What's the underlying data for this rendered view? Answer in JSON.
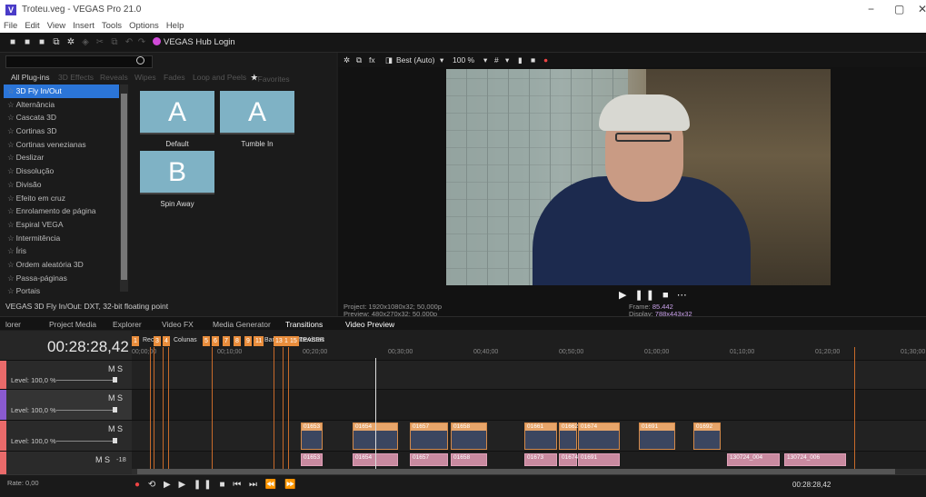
{
  "window": {
    "title": "Troteu.veg - VEGAS Pro 21.0",
    "minimize": "−",
    "maximize": "▢",
    "close": "✕"
  },
  "menu": [
    "File",
    "Edit",
    "View",
    "Insert",
    "Tools",
    "Options",
    "Help"
  ],
  "toolbar": {
    "hub_label": "VEGAS Hub Login"
  },
  "plugins": {
    "tabs": [
      "All Plug-ins",
      "3D Effects",
      "Reveals",
      "Wipes",
      "Fades",
      "Loop and Peels",
      "Favorites"
    ],
    "items": [
      "3D Fly In/Out",
      "Alternância",
      "Cascata 3D",
      "Cortinas 3D",
      "Cortinas venezianas",
      "Deslizar",
      "Dissolução",
      "Divisão",
      "Efeito em cruz",
      "Enrolamento de página",
      "Espiral VEGA",
      "Intermitência",
      "Íris",
      "Ordem aleatória 3D",
      "Passa-páginas",
      "Portais"
    ],
    "selected_index": 0,
    "presets": [
      {
        "glyph": "A",
        "label": "Default"
      },
      {
        "glyph": "A",
        "label": "Tumble In"
      },
      {
        "glyph": "B",
        "label": "Spin Away"
      }
    ],
    "status": "VEGAS 3D Fly In/Out: DXT, 32-bit floating point"
  },
  "window_tabs": [
    "lorer",
    "Project Media",
    "Explorer",
    "Video FX",
    "Media Generator",
    "Transitions",
    "Video Preview"
  ],
  "viewer": {
    "quality": "Best (Auto)",
    "zoom": "100 %",
    "project_label": "Project:",
    "project_value": "1920x1080x32; 50,000p",
    "preview_label": "Preview:",
    "preview_value": "480x270x32; 50,000p",
    "frame_label": "Frame:",
    "frame_value": "85.442",
    "display_label": "Display:",
    "display_value": "788x443x32"
  },
  "timeline": {
    "timecode": "00:28:28,42",
    "markers": [
      {
        "n": "1",
        "label": "Reci"
      },
      {
        "n": "3",
        "label": ""
      },
      {
        "n": "4",
        "label": "Colunas"
      },
      {
        "n": "5",
        "label": ""
      },
      {
        "n": "6",
        "label": ""
      },
      {
        "n": "7",
        "label": ""
      },
      {
        "n": "8",
        "label": ""
      },
      {
        "n": "9",
        "label": ""
      },
      {
        "n": "11",
        "label": "Banh"
      },
      {
        "n": "13",
        "label": ""
      },
      {
        "n": "14",
        "label": "entrevistas"
      },
      {
        "n": "15",
        "label": "TEASER"
      }
    ],
    "ruler": [
      "00;00;00",
      "00;10;00",
      "00;20;00",
      "00;30;00",
      "00;40;00",
      "00;50;00",
      "01;00;00",
      "01;10;00",
      "01;20;00",
      "01;30;00"
    ],
    "tracks": [
      {
        "ms": "M S",
        "level": "Level: 100,0 %",
        "color": "#e96a6a"
      },
      {
        "ms": "M S",
        "level": "Level: 100,0 %",
        "color": "#8a5ad0"
      },
      {
        "ms": "M S",
        "level": "Level: 100,0 %",
        "color": "#e96a6a"
      },
      {
        "ms": "M S",
        "level": "-18",
        "color": "#e96a6a"
      }
    ],
    "clip_labels_v": [
      "01653",
      "01654",
      "01657",
      "01658",
      "01661",
      "01662",
      "01674",
      "01691",
      "01692"
    ],
    "clip_labels_a": [
      "01653",
      "01654",
      "01657",
      "01658",
      "01673",
      "01674",
      "01691",
      "130724_004",
      "130724_006"
    ],
    "rate": "Rate: 0,00",
    "end_timecode": "00:28:28,42"
  }
}
